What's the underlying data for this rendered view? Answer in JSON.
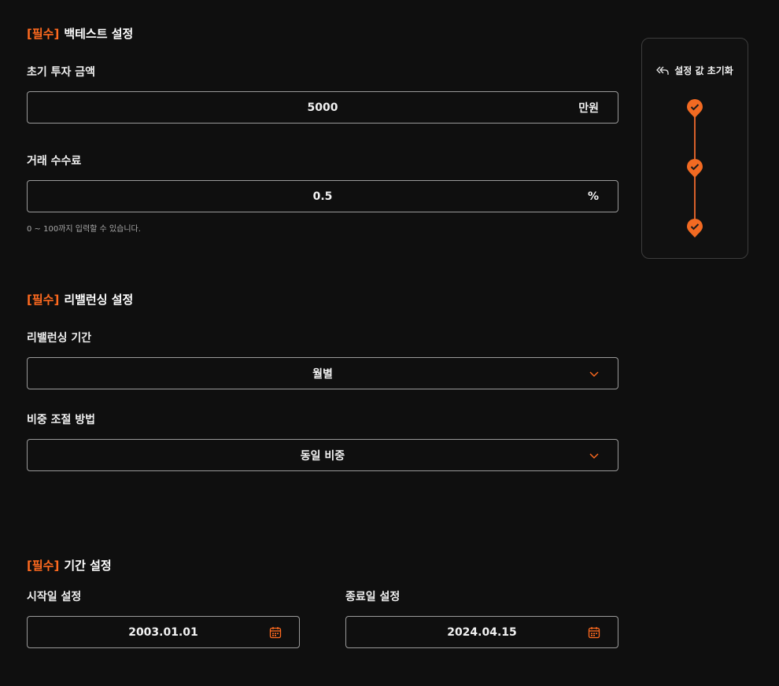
{
  "required_tag": "[필수]",
  "backtest": {
    "title": "백테스트 설정",
    "initial_investment": {
      "label": "초기 투자 금액",
      "value": "5000",
      "unit": "만원"
    },
    "trading_fee": {
      "label": "거래 수수료",
      "value": "0.5",
      "unit": "%",
      "hint": "0 ~ 100까지 입력할 수 있습니다."
    }
  },
  "rebalancing": {
    "title": "리밸런싱 설정",
    "period": {
      "label": "리밸런싱 기간",
      "selected": "월별"
    },
    "weighting": {
      "label": "비중 조절 방법",
      "selected": "동일 비중"
    }
  },
  "period": {
    "title": "기간 설정",
    "start": {
      "label": "시작일 설정",
      "value": "2003.01.01"
    },
    "end": {
      "label": "종료일 설정",
      "value": "2024.04.15"
    }
  },
  "side_panel": {
    "reset_label": "설정 값 초기화",
    "steps_completed": [
      true,
      true,
      true
    ]
  },
  "colors": {
    "accent": "#ff6a1f",
    "background": "#0f0f0f",
    "border": "#9a9a9a"
  },
  "icons": {
    "reset": "undo-arrow-icon",
    "dropdown": "chevron-down-icon",
    "date": "calendar-icon",
    "step": "check-pin-icon"
  }
}
